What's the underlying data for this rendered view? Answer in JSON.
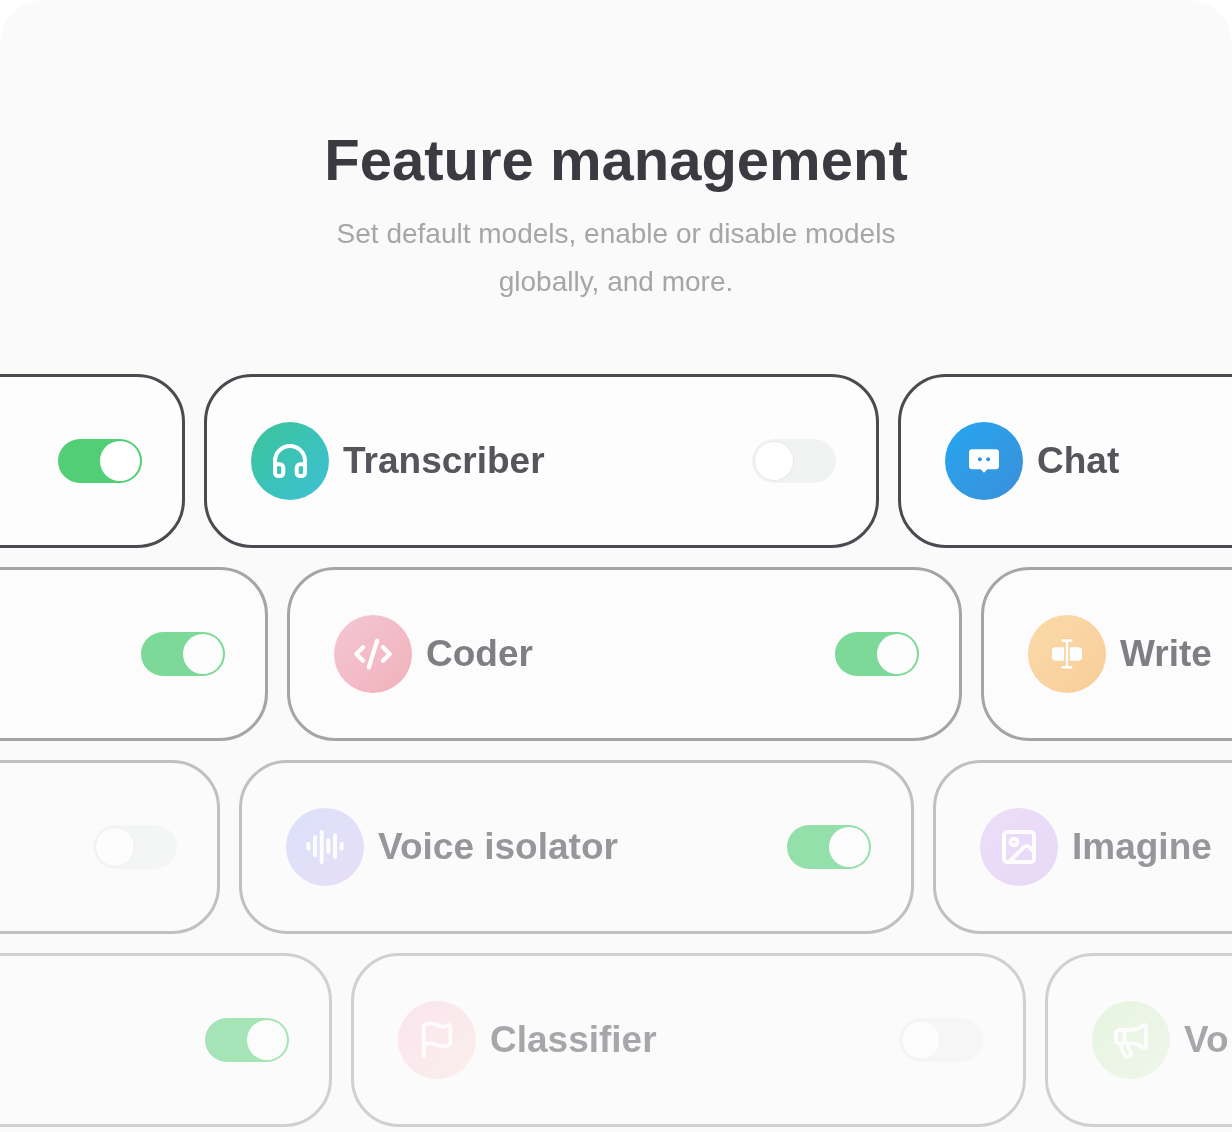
{
  "header": {
    "title": "Feature management",
    "subtitle": "Set default models, enable or disable models globally, and more."
  },
  "rows": [
    {
      "cards": [
        {
          "on": true
        },
        {
          "name": "Transcriber",
          "on": false
        },
        {
          "name": "Chat"
        }
      ]
    },
    {
      "cards": [
        {
          "on": true
        },
        {
          "name": "Coder",
          "on": true
        },
        {
          "name": "Write"
        }
      ]
    },
    {
      "cards": [
        {
          "on": false
        },
        {
          "name": "Voice isolator",
          "on": true
        },
        {
          "name": "Imagine"
        }
      ]
    },
    {
      "cards": [
        {
          "on": true
        },
        {
          "name": "Classifier",
          "on": false
        },
        {
          "name": "Vo"
        }
      ]
    }
  ]
}
